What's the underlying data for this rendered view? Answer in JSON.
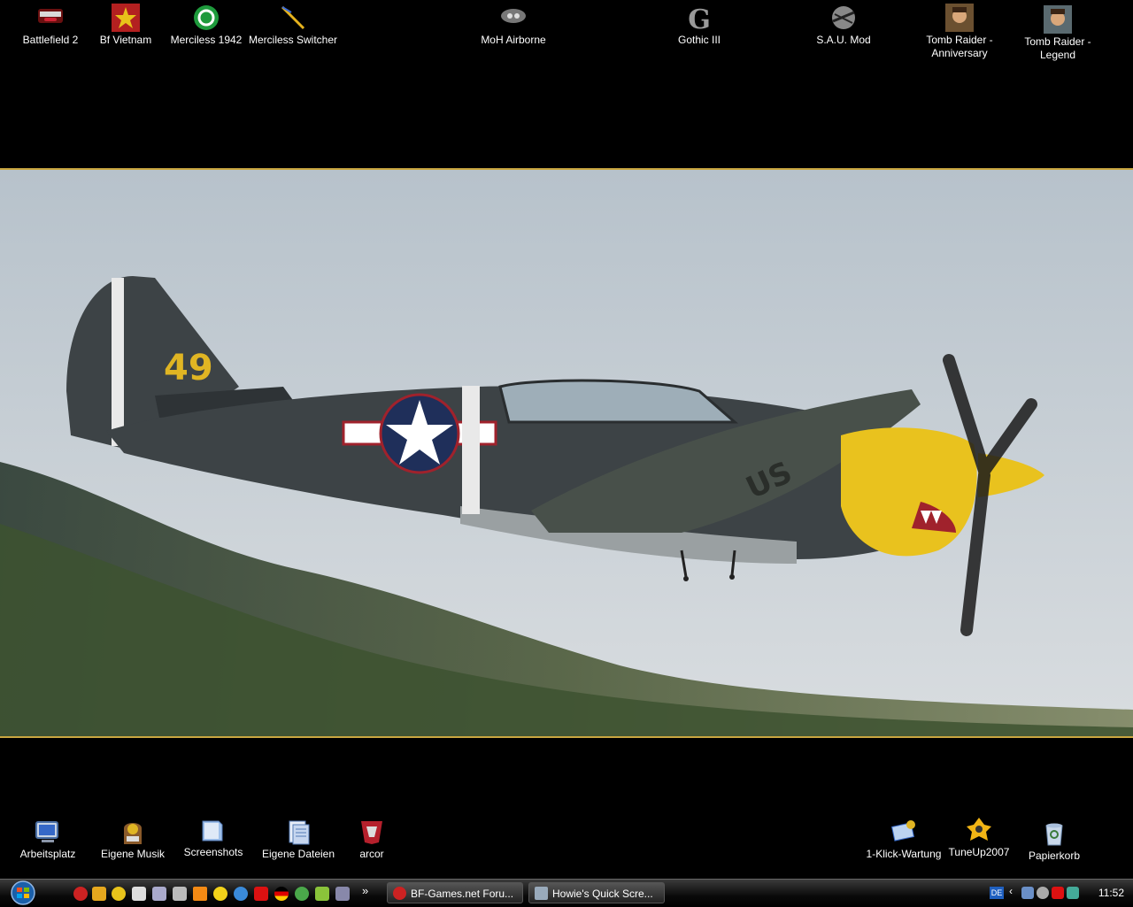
{
  "desktop_icons_top": [
    {
      "label": "Battlefield 2",
      "icon": "battlefield2-icon"
    },
    {
      "label": "Bf Vietnam",
      "icon": "bf-vietnam-star-icon"
    },
    {
      "label": "Merciless 1942",
      "icon": "merciless-1942-icon"
    },
    {
      "label": "Merciless Switcher",
      "icon": "merciless-switcher-icon"
    },
    {
      "label": "MoH Airborne",
      "icon": "moh-airborne-icon"
    },
    {
      "label": "Gothic III",
      "icon": "gothic-iii-icon"
    },
    {
      "label": "S.A.U. Mod",
      "icon": "sau-mod-icon"
    },
    {
      "label": "Tomb Raider - Anniversary",
      "icon": "tomb-raider-anniversary-icon"
    },
    {
      "label": "Tomb Raider - Legend",
      "icon": "tomb-raider-legend-icon"
    }
  ],
  "desktop_icons_bottom": [
    {
      "label": "Arbeitsplatz",
      "icon": "computer-icon"
    },
    {
      "label": "Eigene Musik",
      "icon": "jukebox-icon"
    },
    {
      "label": "Screenshots",
      "icon": "folder-icon"
    },
    {
      "label": "Eigene Dateien",
      "icon": "documents-icon"
    },
    {
      "label": "arcor",
      "icon": "arcor-icon"
    },
    {
      "label": "1-Klick-Wartung",
      "icon": "maintenance-icon"
    },
    {
      "label": "TuneUp2007",
      "icon": "tuneup-icon"
    },
    {
      "label": "Papierkorb",
      "icon": "recycle-bin-icon"
    }
  ],
  "wallpaper": {
    "aircraft_number": "49",
    "wing_marking": "US",
    "colors": {
      "sky": "#c7cfd6",
      "plane": "#3d4346",
      "nose": "#e9c21e",
      "border": "#c9a640"
    }
  },
  "taskbar": {
    "overflow_label": "»",
    "tasks": [
      {
        "label": "BF-Games.net Foru...",
        "icon": "browser-icon"
      },
      {
        "label": "Howie's Quick Scre...",
        "icon": "screenshot-tool-icon"
      }
    ],
    "tray": {
      "language": "DE",
      "clock": "11:52"
    }
  }
}
